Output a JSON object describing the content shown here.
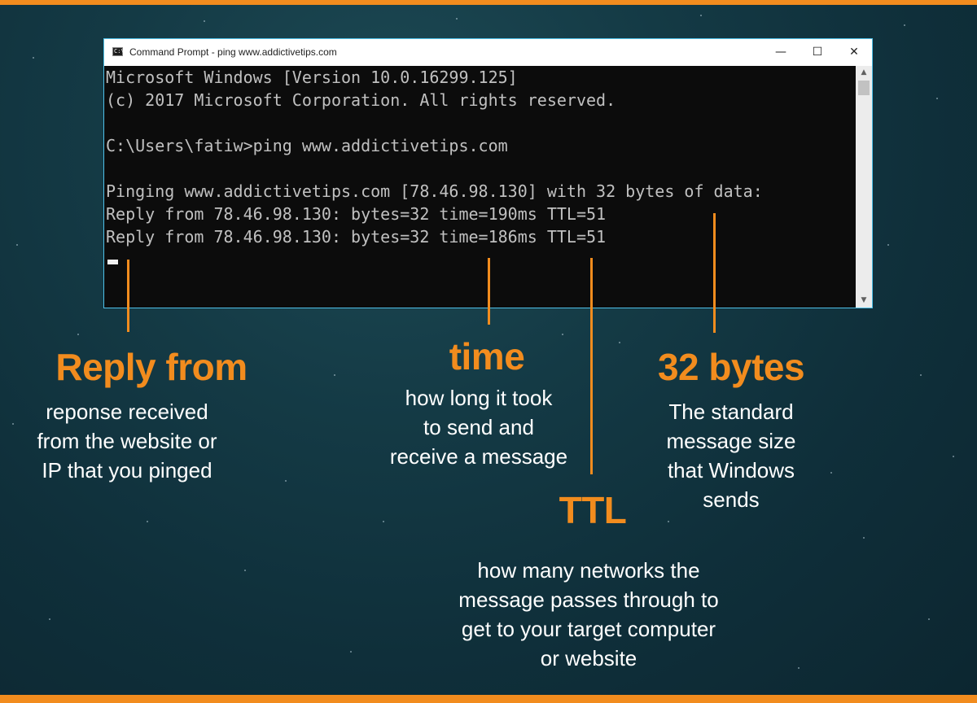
{
  "window": {
    "title": "Command Prompt - ping  www.addictivetips.com",
    "icon_text": "C:\\",
    "controls": {
      "minimize": "—",
      "maximize": "☐",
      "close": "✕"
    }
  },
  "console": {
    "lines": [
      "Microsoft Windows [Version 10.0.16299.125]",
      "(c) 2017 Microsoft Corporation. All rights reserved.",
      "",
      "C:\\Users\\fatiw>ping www.addictivetips.com",
      "",
      "Pinging www.addictivetips.com [78.46.98.130] with 32 bytes of data:",
      "Reply from 78.46.98.130: bytes=32 time=190ms TTL=51",
      "Reply from 78.46.98.130: bytes=32 time=186ms TTL=51"
    ]
  },
  "scrollbar": {
    "up": "▲",
    "down": "▼"
  },
  "annotations": {
    "reply_from": {
      "title": "Reply from",
      "lines": [
        "reponse received",
        "from the website or",
        "IP that you pinged"
      ]
    },
    "time": {
      "title": "time",
      "lines": [
        "how long it took",
        "to send and",
        "receive a message"
      ]
    },
    "ttl": {
      "title": "TTL",
      "lines": [
        "how many networks the",
        "message passes through to",
        "get to your target computer",
        "or website"
      ]
    },
    "bytes": {
      "title": "32 bytes",
      "lines": [
        "The standard",
        "message size",
        "that Windows",
        "sends"
      ]
    }
  },
  "colors": {
    "accent": "#f28c1e",
    "window_border": "#4fc0e8",
    "console_bg": "#0c0c0c",
    "console_text": "#c0c0c0"
  }
}
